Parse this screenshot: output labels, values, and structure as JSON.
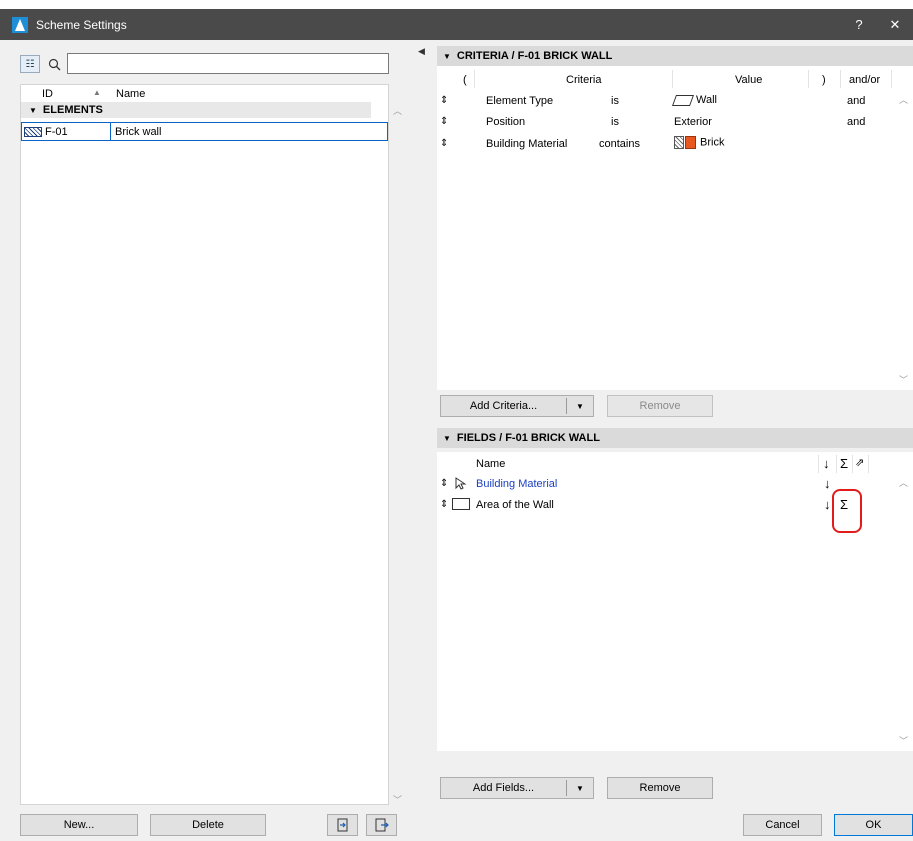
{
  "window": {
    "title": "Scheme Settings",
    "help_label": "?",
    "close_label": "✕"
  },
  "left_panel": {
    "search": {
      "value": "",
      "placeholder": ""
    },
    "columns": {
      "id": "ID",
      "name": "Name"
    },
    "group": {
      "label": "ELEMENTS"
    },
    "rows": [
      {
        "id": "F-01",
        "name": "Brick wall"
      }
    ],
    "buttons": {
      "new": "New...",
      "delete": "Delete"
    }
  },
  "criteria": {
    "heading": "CRITERIA / F-01 BRICK WALL",
    "columns": {
      "open": "(",
      "criteria": "Criteria",
      "value": "Value",
      "close": ")",
      "andor": "and/or"
    },
    "rows": [
      {
        "handle": "⇕",
        "criteria": "Element Type",
        "operator": "is",
        "value": "Wall",
        "value_icon": "wall-icon",
        "andor": "and"
      },
      {
        "handle": "⇕",
        "criteria": "Position",
        "operator": "is",
        "value": "Exterior",
        "value_icon": "",
        "andor": "and"
      },
      {
        "handle": "⇕",
        "criteria": "Building Material",
        "operator": "contains",
        "value": "Brick",
        "value_icon": "brick-material-icon",
        "andor": ""
      }
    ],
    "add_button": "Add Criteria...",
    "remove_button": "Remove"
  },
  "fields": {
    "heading": "FIELDS / F-01 BRICK WALL",
    "columns": {
      "name": "Name",
      "sort": "↓",
      "sum": "Σ",
      "pin": "⇗"
    },
    "rows": [
      {
        "handle": "⇕",
        "icon": "pointer-icon",
        "name": "Building Material",
        "name_color": "#1a3fc0",
        "sort": "↓",
        "sum": ""
      },
      {
        "handle": "⇕",
        "icon": "field-shape-icon",
        "name": "Area of the Wall",
        "name_color": "#000000",
        "sort": "↓",
        "sum": "Σ"
      }
    ],
    "add_button": "Add Fields...",
    "remove_button": "Remove"
  },
  "footer": {
    "cancel": "Cancel",
    "ok": "OK"
  },
  "colors": {
    "titlebar": "#4a4a4a",
    "selection": "#0a64c8",
    "highlight": "#e21b1b",
    "brick": "#e8571f"
  }
}
